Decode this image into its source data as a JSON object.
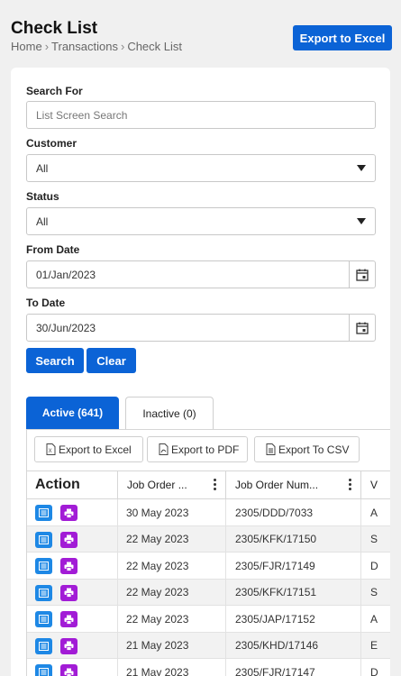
{
  "page": {
    "title": "Check List",
    "breadcrumb": [
      "Home",
      "Transactions",
      "Check List"
    ],
    "breadcrumb_sep": "›",
    "export_excel_label": "Export to Excel"
  },
  "filters": {
    "search_label": "Search For",
    "search_placeholder": "List Screen Search",
    "customer_label": "Customer",
    "customer_value": "All",
    "status_label": "Status",
    "status_value": "All",
    "from_date_label": "From Date",
    "from_date_value": "01/Jan/2023",
    "to_date_label": "To Date",
    "to_date_value": "30/Jun/2023",
    "search_button": "Search",
    "clear_button": "Clear"
  },
  "tabs": {
    "active_label": "Active (641)",
    "inactive_label": "Inactive (0)"
  },
  "toolbar": {
    "excel": "Export to Excel",
    "pdf": "Export to PDF",
    "csv": "Export To CSV"
  },
  "table": {
    "columns": [
      "Action",
      "Job Order ...",
      "Job Order Num...",
      "V"
    ],
    "rows": [
      {
        "date": "30 May 2023",
        "job": "2305/DDD/7033",
        "v": "A"
      },
      {
        "date": "22 May 2023",
        "job": "2305/KFK/17150",
        "v": "S"
      },
      {
        "date": "22 May 2023",
        "job": "2305/FJR/17149",
        "v": "D"
      },
      {
        "date": "22 May 2023",
        "job": "2305/KFK/17151",
        "v": "S"
      },
      {
        "date": "22 May 2023",
        "job": "2305/JAP/17152",
        "v": "A"
      },
      {
        "date": "21 May 2023",
        "job": "2305/KHD/17146",
        "v": "E"
      },
      {
        "date": "21 May 2023",
        "job": "2305/FJR/17147",
        "v": "D"
      }
    ]
  },
  "colors": {
    "primary": "#0b63d6",
    "view_icon": "#1e88e5",
    "print_icon": "#a21cd6"
  },
  "icons": [
    "calendar-icon",
    "excel-file-icon",
    "pdf-file-icon",
    "csv-file-icon",
    "view-icon",
    "print-icon",
    "kebab-menu-icon",
    "caret-down-icon"
  ]
}
